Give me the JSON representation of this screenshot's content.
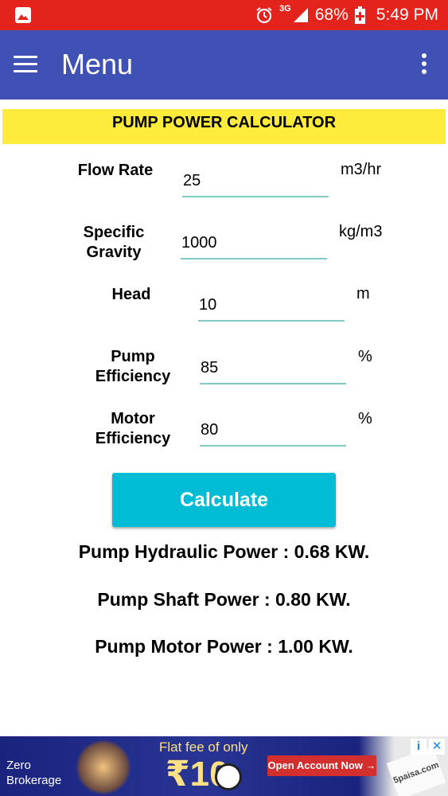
{
  "status_bar": {
    "network": "3G",
    "battery": "68%",
    "time": "5:49 PM"
  },
  "app_bar": {
    "title": "Menu"
  },
  "banner": {
    "title": "PUMP POWER CALCULATOR"
  },
  "form": {
    "flow_rate": {
      "label": "Flow Rate",
      "value": "25",
      "unit": "m3/hr"
    },
    "specific_gravity": {
      "label_line1": "Specific",
      "label_line2": "Gravity",
      "value": "1000",
      "unit": "kg/m3"
    },
    "head": {
      "label": "Head",
      "value": "10",
      "unit": "m"
    },
    "pump_efficiency": {
      "label_line1": "Pump",
      "label_line2": "Efficiency",
      "value": "85",
      "unit": "%"
    },
    "motor_efficiency": {
      "label_line1": "Motor",
      "label_line2": "Efficiency",
      "value": "80",
      "unit": "%"
    }
  },
  "calculate_label": "Calculate",
  "results": {
    "hydraulic": "Pump Hydraulic Power : 0.68 KW.",
    "shaft": "Pump Shaft Power : 0.80 KW.",
    "motor": "Pump Motor Power : 1.00 KW."
  },
  "ad": {
    "left_line1": "Zero",
    "left_line2": "Brokerage",
    "headline": "Flat fee of only",
    "amount": "₹10",
    "cta": "Open Account Now →",
    "brand": "5paisa.com",
    "info_icon": "i",
    "close_icon": "✕"
  },
  "colors": {
    "status_bar": "#e5231d",
    "app_bar": "#3f51b5",
    "banner": "#ffeb3b",
    "button": "#00bcd4",
    "underline": "#80cbc4"
  }
}
